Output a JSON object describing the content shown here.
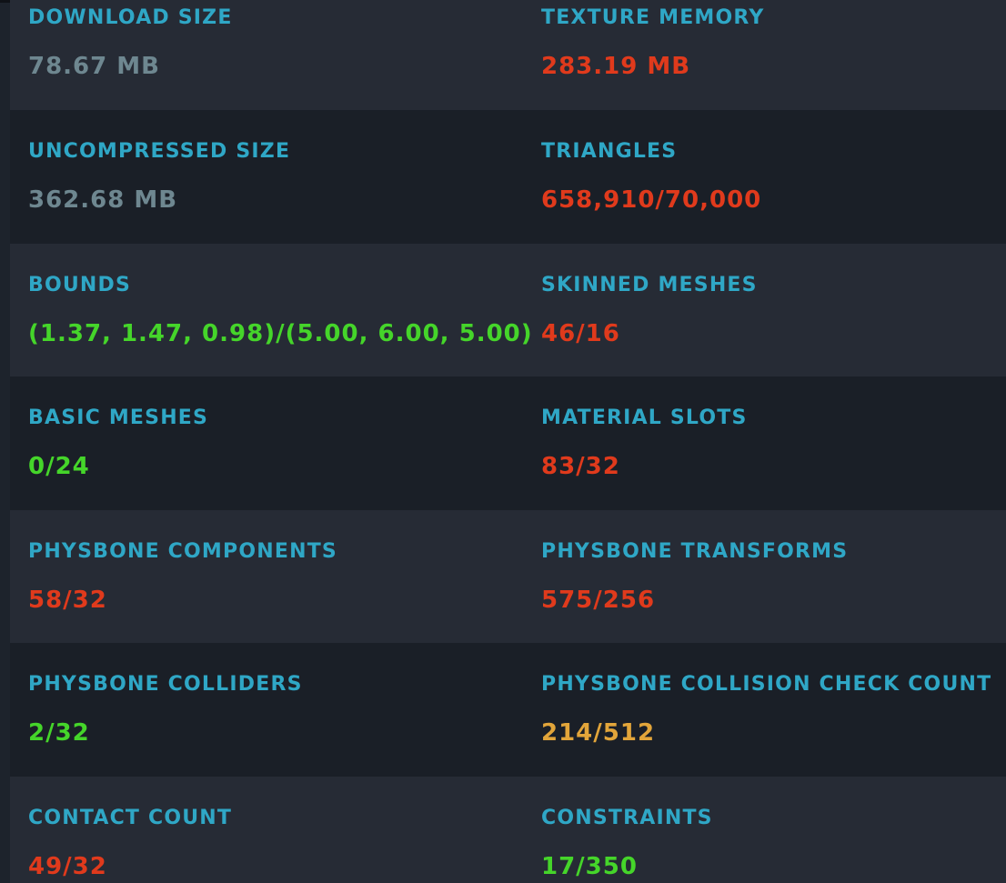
{
  "stats": [
    {
      "left": {
        "label": "DOWNLOAD SIZE",
        "value": "78.67 MB",
        "status": "neutral"
      },
      "right": {
        "label": "TEXTURE MEMORY",
        "value": "283.19 MB",
        "status": "bad"
      }
    },
    {
      "left": {
        "label": "UNCOMPRESSED SIZE",
        "value": "362.68 MB",
        "status": "neutral"
      },
      "right": {
        "label": "TRIANGLES",
        "value": "658,910/70,000",
        "status": "bad"
      }
    },
    {
      "left": {
        "label": "BOUNDS",
        "value": "(1.37, 1.47, 0.98)/(5.00, 6.00, 5.00)",
        "status": "good"
      },
      "right": {
        "label": "SKINNED MESHES",
        "value": "46/16",
        "status": "bad"
      }
    },
    {
      "left": {
        "label": "BASIC MESHES",
        "value": "0/24",
        "status": "good"
      },
      "right": {
        "label": "MATERIAL SLOTS",
        "value": "83/32",
        "status": "bad"
      }
    },
    {
      "left": {
        "label": "PHYSBONE COMPONENTS",
        "value": "58/32",
        "status": "bad"
      },
      "right": {
        "label": "PHYSBONE TRANSFORMS",
        "value": "575/256",
        "status": "bad"
      }
    },
    {
      "left": {
        "label": "PHYSBONE COLLIDERS",
        "value": "2/32",
        "status": "good"
      },
      "right": {
        "label": "PHYSBONE COLLISION CHECK COUNT",
        "value": "214/512",
        "status": "warn"
      }
    },
    {
      "left": {
        "label": "CONTACT COUNT",
        "value": "49/32",
        "status": "bad"
      },
      "right": {
        "label": "CONSTRAINTS",
        "value": "17/350",
        "status": "good"
      }
    }
  ],
  "colors": {
    "label": "#2fa7c6",
    "neutral": "#6e8790",
    "bad": "#e03a1c",
    "good": "#45d52a",
    "warn": "#e2a53a",
    "row_light": "#262b35",
    "row_dark": "#1a1f27"
  }
}
